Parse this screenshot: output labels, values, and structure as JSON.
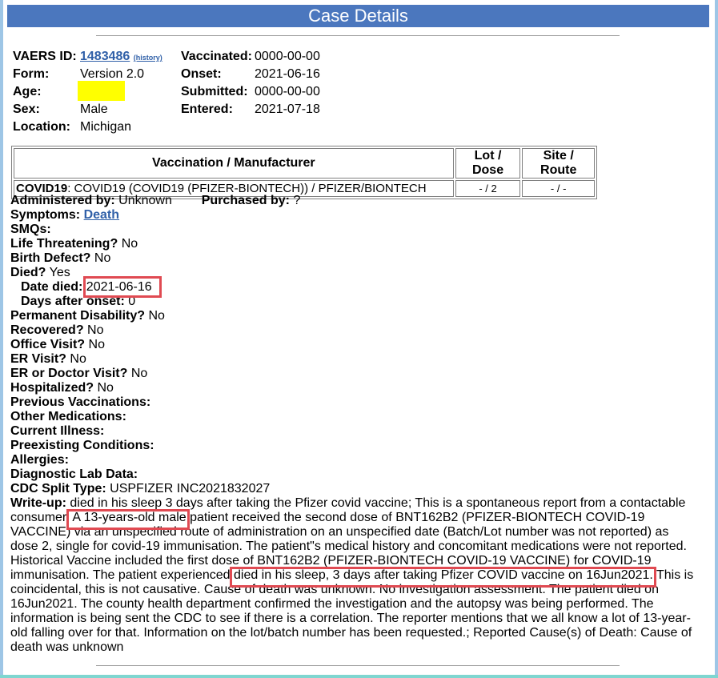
{
  "header": {
    "title": "Case Details"
  },
  "case": {
    "vaers_id_label": "VAERS ID:",
    "vaers_id": "1483486",
    "history_link": "(history)",
    "form_label": "Form:",
    "form": "Version 2.0",
    "age_label": "Age:",
    "age": "",
    "sex_label": "Sex:",
    "sex": "Male",
    "location_label": "Location:",
    "location": "Michigan",
    "vaccinated_label": "Vaccinated:",
    "vaccinated": "0000-00-00",
    "onset_label": "Onset:",
    "onset": "2021-06-16",
    "submitted_label": "Submitted:",
    "submitted": "0000-00-00",
    "entered_label": "Entered:",
    "entered": "2021-07-18"
  },
  "vaccine_table": {
    "headers": [
      "Vaccination / Manufacturer",
      "Lot / Dose",
      "Site / Route"
    ],
    "rows": [
      {
        "vax_bold": "COVID19",
        "vax_rest": ": COVID19 (COVID19 (PFIZER-BIONTECH)) / PFIZER/BIONTECH",
        "lot_dose": "- / 2",
        "site_route": "- / -"
      }
    ]
  },
  "details": {
    "administered_by_label": "Administered by:",
    "administered_by": "Unknown",
    "purchased_by_label": "Purchased by:",
    "purchased_by": "?",
    "symptoms_label": "Symptoms:",
    "symptoms_link": "Death",
    "smqs_label": "SMQs:",
    "life_threatening_label": "Life Threatening?",
    "life_threatening": "No",
    "birth_defect_label": "Birth Defect?",
    "birth_defect": "No",
    "died_label": "Died?",
    "died": "Yes",
    "date_died_label": "Date died:",
    "date_died": "2021-06-16",
    "days_after_onset_label": "Days after onset:",
    "days_after_onset": "0",
    "perm_disability_label": "Permanent Disability?",
    "perm_disability": "No",
    "recovered_label": "Recovered?",
    "recovered": "No",
    "office_visit_label": "Office Visit?",
    "office_visit": "No",
    "er_visit_label": "ER Visit?",
    "er_visit": "No",
    "er_doctor_label": "ER or Doctor Visit?",
    "er_doctor": "No",
    "hospitalized_label": "Hospitalized?",
    "hospitalized": "No",
    "prev_vax_label": "Previous Vaccinations:",
    "other_meds_label": "Other Medications:",
    "current_illness_label": "Current Illness:",
    "preexisting_label": "Preexisting Conditions:",
    "allergies_label": "Allergies:",
    "diag_lab_label": "Diagnostic Lab Data:",
    "cdc_split_label": "CDC Split Type:",
    "cdc_split": "USPFIZER INC2021832027",
    "writeup_label": "Write-up:",
    "writeup_1": "died in his sleep 3 days after taking the Pfizer covid vaccine; This is a spontaneous report from a contactable consumer.",
    "writeup_hl1": "A 13-years-old male",
    "writeup_2": "patient received the second dose of BNT162B2 (PFIZER-BIONTECH COVID-19 VACCINE) via an unspecified route of administration on an unspecified date (Batch/Lot number was not reported) as dose 2, single for covid-19 immunisation. The patient\"s medical history and concomitant medications were not reported. Historical Vaccine included the first dose of BNT162B2 (PFIZER-BIONTECH COVID-19 VACCINE) for COVID-19 immunisation. The patient experienced",
    "writeup_hl2": "died in his sleep, 3 days after taking Pfizer COVID vaccine on 16Jun2021.",
    "writeup_3": "This is coincidental, this is not causative. Cause of death was unknown. No investigation assessment. The patient died on 16Jun2021. The county health department confirmed the investigation and the autopsy was being performed. The information is being sent the CDC to see if there is a correlation. The reporter mentions that we all know a lot of 13-year-old falling over for that. Information on the lot/batch number has been requested.; Reported Cause(s) of Death: Cause of death was unknown"
  },
  "colors": {
    "header_bg": "#4b77be",
    "link": "#3060a8",
    "highlight_box": "#e04a52",
    "redaction": "#ffff00"
  }
}
